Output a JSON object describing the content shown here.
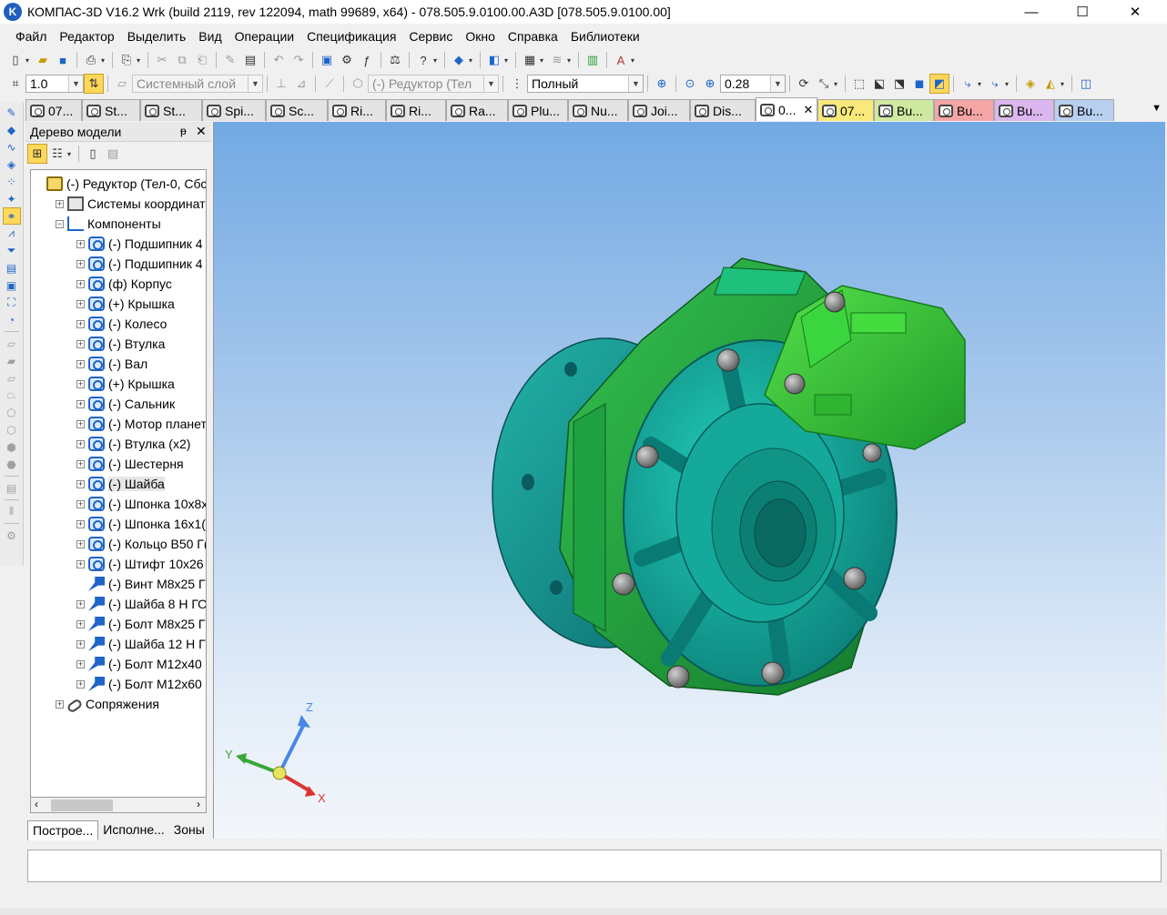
{
  "window": {
    "title": "КОМПАС-3D V16.2 Wrk (build 2119, rev 122094, math 99689, x64) - 078.505.9.0100.00.A3D [078.505.9.0100.00]",
    "logo_letter": "K",
    "controls": {
      "minimize": "—",
      "maximize": "☐",
      "close": "✕"
    }
  },
  "menu": [
    "Файл",
    "Редактор",
    "Выделить",
    "Вид",
    "Операции",
    "Спецификация",
    "Сервис",
    "Окно",
    "Справка",
    "Библиотеки"
  ],
  "toolbar2": {
    "step_value": "1.0",
    "layer_value": "Системный слой",
    "component_value": "(-) Редуктор (Тел",
    "filter_value": "Полный",
    "zoom_value": "0.28"
  },
  "tabs": [
    {
      "label": "07...",
      "color": "default"
    },
    {
      "label": "St...",
      "color": "default"
    },
    {
      "label": "St...",
      "color": "default"
    },
    {
      "label": "Spi...",
      "color": "default"
    },
    {
      "label": "Sc...",
      "color": "default"
    },
    {
      "label": "Ri...",
      "color": "default"
    },
    {
      "label": "Ri...",
      "color": "default"
    },
    {
      "label": "Ra...",
      "color": "default"
    },
    {
      "label": "Plu...",
      "color": "default"
    },
    {
      "label": "Nu...",
      "color": "default"
    },
    {
      "label": "Joi...",
      "color": "default"
    },
    {
      "label": "Dis...",
      "color": "default"
    },
    {
      "label": "0...",
      "color": "active",
      "close": "✕"
    },
    {
      "label": "07...",
      "color": "yellow"
    },
    {
      "label": "Bu...",
      "color": "green"
    },
    {
      "label": "Bu...",
      "color": "red"
    },
    {
      "label": "Bu...",
      "color": "purple"
    },
    {
      "label": "Bu...",
      "color": "blue"
    }
  ],
  "panel": {
    "title": "Дерево модели",
    "pin": "ᵽ",
    "close": "✕",
    "bottom_tabs": [
      "Построе...",
      "Исполне...",
      "Зоны"
    ]
  },
  "tree": [
    {
      "label": "(-) Редуктор (Тел-0, Сбс",
      "icon": "asm",
      "level": 0,
      "exp": ""
    },
    {
      "label": "Системы координат",
      "icon": "coord",
      "level": 1,
      "exp": "+"
    },
    {
      "label": "Компоненты",
      "icon": "comp",
      "level": 1,
      "exp": "−"
    },
    {
      "label": "(-) Подшипник 4",
      "icon": "part",
      "level": 2,
      "exp": "+"
    },
    {
      "label": "(-) Подшипник 4",
      "icon": "part",
      "level": 2,
      "exp": "+"
    },
    {
      "label": "(ф) Корпус",
      "icon": "part",
      "level": 2,
      "exp": "+"
    },
    {
      "label": "(+) Крышка",
      "icon": "part",
      "level": 2,
      "exp": "+"
    },
    {
      "label": "(-) Колесо",
      "icon": "part",
      "level": 2,
      "exp": "+"
    },
    {
      "label": "(-) Втулка",
      "icon": "part",
      "level": 2,
      "exp": "+"
    },
    {
      "label": "(-) Вал",
      "icon": "part",
      "level": 2,
      "exp": "+"
    },
    {
      "label": "(+) Крышка",
      "icon": "part",
      "level": 2,
      "exp": "+"
    },
    {
      "label": "(-) Сальник",
      "icon": "part",
      "level": 2,
      "exp": "+"
    },
    {
      "label": "(-) Мотор планет",
      "icon": "part",
      "level": 2,
      "exp": "+"
    },
    {
      "label": "(-) Втулка (x2)",
      "icon": "part",
      "level": 2,
      "exp": "+"
    },
    {
      "label": "(-) Шестерня",
      "icon": "part",
      "level": 2,
      "exp": "+"
    },
    {
      "label": "(-) Шайба",
      "icon": "part",
      "level": 2,
      "exp": "+",
      "selected": true
    },
    {
      "label": "(-) Шпонка 10x8x",
      "icon": "part",
      "level": 2,
      "exp": "+"
    },
    {
      "label": "(-) Шпонка 16x1(",
      "icon": "part",
      "level": 2,
      "exp": "+"
    },
    {
      "label": "(-) Кольцо B50 Г(",
      "icon": "part",
      "level": 2,
      "exp": "+"
    },
    {
      "label": "(-) Штифт 10x26 I",
      "icon": "part",
      "level": 2,
      "exp": "+"
    },
    {
      "label": "(-) Винт M8x25 Г(",
      "icon": "std",
      "level": 2,
      "exp": ""
    },
    {
      "label": "(-) Шайба 8 Н ГО",
      "icon": "std",
      "level": 2,
      "exp": "+"
    },
    {
      "label": "(-) Болт M8x25 Г(",
      "icon": "std",
      "level": 2,
      "exp": "+"
    },
    {
      "label": "(-) Шайба 12 Н Г",
      "icon": "std",
      "level": 2,
      "exp": "+"
    },
    {
      "label": "(-) Болт M12x40 I",
      "icon": "std",
      "level": 2,
      "exp": "+"
    },
    {
      "label": "(-) Болт M12x60 I",
      "icon": "std",
      "level": 2,
      "exp": "+"
    },
    {
      "label": "Сопряжения",
      "icon": "mate",
      "level": 1,
      "exp": "+"
    }
  ],
  "axes": {
    "x": "X",
    "y": "Y",
    "z": "Z"
  },
  "colors": {
    "housing_green": "#1f9a3c",
    "cover_teal": "#1ab8a6",
    "motor_green": "#2dc23a",
    "bolt_gray": "#8a8a8a",
    "viewport_top": "#72a9e3"
  }
}
